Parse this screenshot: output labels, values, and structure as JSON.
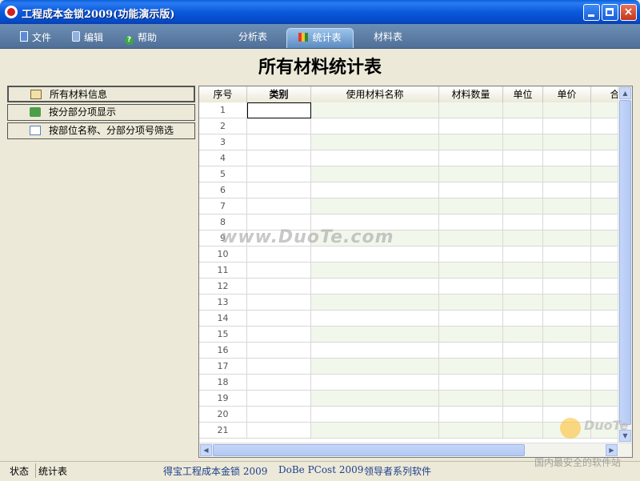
{
  "window": {
    "title": "工程成本金锁2009(功能演示版)",
    "close_glyph": "×"
  },
  "menu": {
    "file": "文件",
    "edit": "编辑",
    "help": "帮助",
    "help_glyph": "?"
  },
  "tabs": {
    "analysis": "分析表",
    "stats": "统计表",
    "material": "材料表"
  },
  "page_title": "所有材料统计表",
  "nav": [
    {
      "label": "所有材料信息"
    },
    {
      "label": "按分部分项显示"
    },
    {
      "label": "按部位名称、分部分项号筛选"
    }
  ],
  "grid": {
    "columns": [
      "序号",
      "类别",
      "使用材料名称",
      "材料数量",
      "单位",
      "单价",
      "合"
    ],
    "rows": [
      "1",
      "2",
      "3",
      "4",
      "5",
      "6",
      "7",
      "8",
      "9",
      "10",
      "11",
      "12",
      "13",
      "14",
      "15",
      "16",
      "17",
      "18",
      "19",
      "20",
      "21"
    ],
    "selected_row": "1",
    "selected_column": "类别"
  },
  "scroll": {
    "up": "▲",
    "down": "▼",
    "left": "◀",
    "right": "▶"
  },
  "watermark": "www.DuoTe.com",
  "status": {
    "label": "状态",
    "value": "统计表",
    "product": "得宝工程成本金锁 2009",
    "version": "DoBe PCost 2009",
    "series": "领导者系列软件"
  },
  "corner": {
    "logo_text": "DuoTe",
    "tagline": "国内最安全的软件站"
  }
}
